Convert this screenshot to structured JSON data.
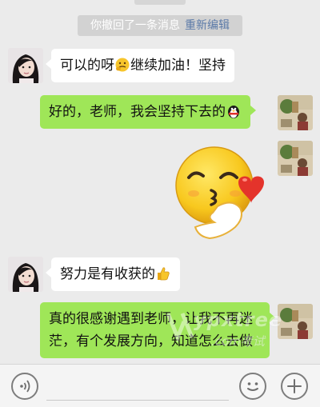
{
  "system_notice": {
    "text": "你撤回了一条消息",
    "action": "重新编辑"
  },
  "messages": [
    {
      "side": "left",
      "sender": "teacher",
      "text": "可以的呀",
      "emoji": "thinking-face-emoji",
      "text_after": "继续加油！坚持"
    },
    {
      "side": "right",
      "sender": "me",
      "text": "好的，老师，我会坚持下去的",
      "emoji": "penguin-emoji"
    },
    {
      "side": "right",
      "sender": "me",
      "type": "sticker",
      "sticker": "kissing-heart-face-sticker"
    },
    {
      "side": "left",
      "sender": "teacher",
      "text": "努力是有收获的",
      "emoji": "thumbs-up-emoji"
    },
    {
      "side": "right",
      "sender": "me",
      "line1": "真的很感谢遇到老师，让我不再迷",
      "line2": "茫，有个发展方向，知道怎么去做"
    }
  ],
  "watermark": {
    "main": "ypxtree",
    "sub": ".com考试"
  },
  "input_bar": {
    "left_icon": "voice-icon",
    "placeholder": "",
    "right_icons": [
      "emoji-face-icon",
      "plus-icon"
    ]
  },
  "colors": {
    "background": "#ebebeb",
    "bubble_left": "#ffffff",
    "bubble_right": "#9fe658",
    "link": "#5b7aa8"
  }
}
